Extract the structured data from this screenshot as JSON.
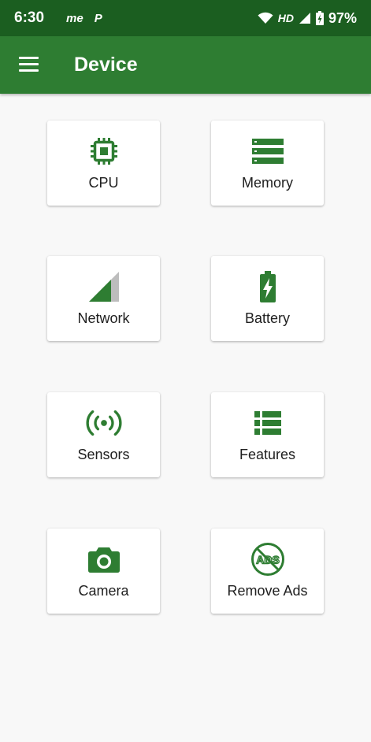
{
  "status_bar": {
    "time": "6:30",
    "app_icon_1": "me",
    "app_icon_2": "P",
    "network_type": "HD",
    "battery_percent": "97%",
    "icons": [
      "wifi-icon",
      "signal-icon",
      "battery-charging-icon"
    ]
  },
  "app_bar": {
    "title": "Device",
    "menu_icon": "hamburger-menu-icon"
  },
  "colors": {
    "status_bar": "#1b5e20",
    "app_bar": "#2e7d32",
    "accent_icon": "#2e7d32",
    "background": "#f8f8f8",
    "card": "#ffffff"
  },
  "cards": [
    {
      "label": "CPU",
      "icon": "cpu-chip-icon"
    },
    {
      "label": "Memory",
      "icon": "memory-storage-icon"
    },
    {
      "label": "Network",
      "icon": "network-signal-icon"
    },
    {
      "label": "Battery",
      "icon": "battery-charging-icon"
    },
    {
      "label": "Sensors",
      "icon": "sensors-icon"
    },
    {
      "label": "Features",
      "icon": "features-list-icon"
    },
    {
      "label": "Camera",
      "icon": "camera-icon"
    },
    {
      "label": "Remove Ads",
      "icon": "no-ads-icon"
    }
  ]
}
